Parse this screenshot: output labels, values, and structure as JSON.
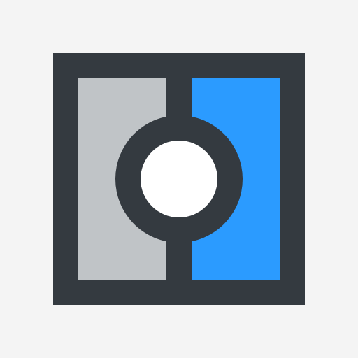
{
  "colors": {
    "background": "#f4f4f4",
    "frame": "#343a40",
    "left_panel": "#c0c4c7",
    "right_panel": "#2b9bff",
    "center_knob": "#ffffff"
  },
  "icon": {
    "name": "compare-slider-icon"
  }
}
